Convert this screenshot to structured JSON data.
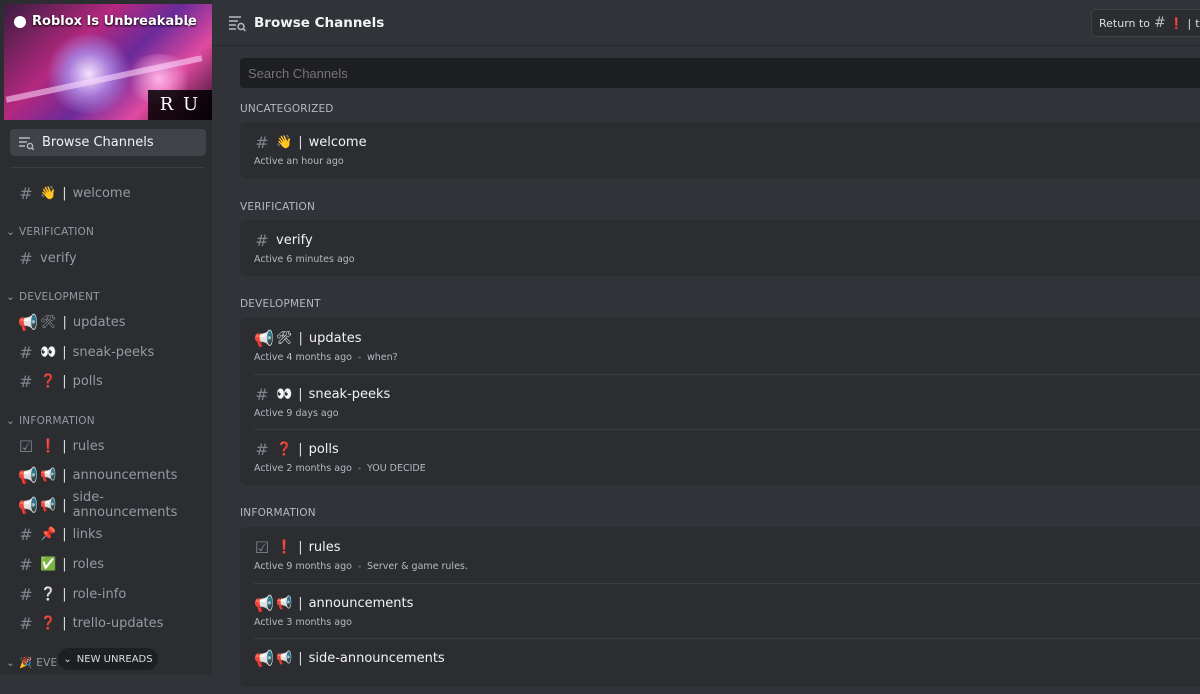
{
  "server": {
    "name": "Roblox Is Unbreakable",
    "logo_text": "R U"
  },
  "sidebar": {
    "browse_label": "Browse Channels",
    "items_top": [
      {
        "emoji": "👋",
        "label": "welcome"
      }
    ],
    "categories": [
      {
        "name": "VERIFICATION",
        "items": [
          {
            "emoji": "",
            "label": "verify"
          }
        ]
      },
      {
        "name": "DEVELOPMENT",
        "items": [
          {
            "emoji": "🛠",
            "label": "updates"
          },
          {
            "emoji": "👀",
            "label": "sneak-peeks"
          },
          {
            "emoji": "❓",
            "label": "polls"
          }
        ]
      },
      {
        "name": "INFORMATION",
        "items": [
          {
            "emoji": "❗",
            "label": "rules"
          },
          {
            "emoji": "📢",
            "label": "announcements"
          },
          {
            "emoji": "📢",
            "label": "side-announcements"
          },
          {
            "emoji": "📌",
            "label": "links"
          },
          {
            "emoji": "✅",
            "label": "roles"
          },
          {
            "emoji": "❔",
            "label": "role-info"
          },
          {
            "emoji": "❓",
            "label": "trello-updates"
          }
        ]
      },
      {
        "name": "EVE",
        "items": []
      }
    ],
    "new_unreads": "NEW UNREADS"
  },
  "header": {
    "title": "Browse Channels",
    "return_label": "Return to",
    "return_channel": "tradin"
  },
  "search": {
    "placeholder": "Search Channels"
  },
  "sections": [
    {
      "name": "UNCATEGORIZED",
      "channels": [
        {
          "emoji": "👋",
          "name": "welcome",
          "active": "Active an hour ago",
          "topic": ""
        }
      ]
    },
    {
      "name": "VERIFICATION",
      "channels": [
        {
          "emoji": "",
          "name": "verify",
          "active": "Active 6 minutes ago",
          "topic": ""
        }
      ]
    },
    {
      "name": "DEVELOPMENT",
      "channels": [
        {
          "emoji": "🛠",
          "name": "updates",
          "active": "Active 4 months ago",
          "topic": "when?"
        },
        {
          "emoji": "👀",
          "name": "sneak-peeks",
          "active": "Active 9 days ago",
          "topic": ""
        },
        {
          "emoji": "❓",
          "name": "polls",
          "active": "Active 2 months ago",
          "topic": "YOU DECIDE"
        }
      ]
    },
    {
      "name": "INFORMATION",
      "channels": [
        {
          "emoji": "❗",
          "name": "rules",
          "active": "Active 9 months ago",
          "topic": "Server & game rules."
        },
        {
          "emoji": "📢",
          "name": "announcements",
          "active": "Active 3 months ago",
          "topic": ""
        },
        {
          "emoji": "📢",
          "name": "side-announcements",
          "active": "",
          "topic": ""
        }
      ]
    }
  ],
  "colors": {
    "background": "#313338",
    "sidebar": "#2b2d31",
    "card": "#2b2d31",
    "search": "#1e1f22"
  }
}
